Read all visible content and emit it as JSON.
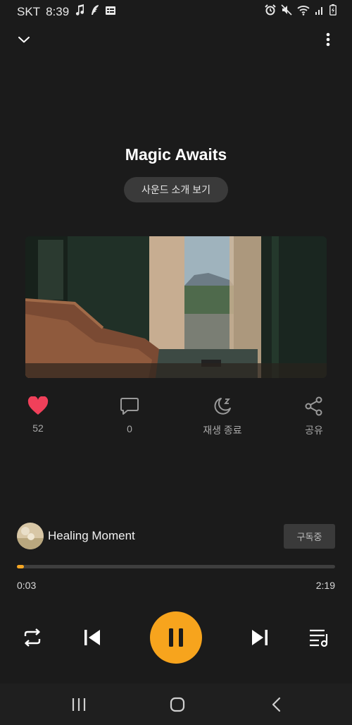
{
  "status_bar": {
    "carrier": "SKT",
    "time": "8:39"
  },
  "track": {
    "title": "Magic Awaits",
    "intro_button": "사운드 소개 보기"
  },
  "actions": {
    "like_count": "52",
    "comment_count": "0",
    "sleep_timer_label": "재생 종료",
    "share_label": "공유"
  },
  "channel": {
    "name": "Healing Moment",
    "subscribe_label": "구독중"
  },
  "playback": {
    "elapsed": "0:03",
    "duration": "2:19",
    "progress": 0.0216
  },
  "colors": {
    "accent": "#f7a41d",
    "like": "#f0405a",
    "background": "#1b1b1b"
  },
  "icons": {
    "collapse": "chevron-down-icon",
    "more": "more-vertical-icon",
    "like": "heart-icon",
    "comment": "comment-icon",
    "sleep": "moon-sleep-icon",
    "share": "share-icon",
    "repeat": "repeat-icon",
    "previous": "skip-previous-icon",
    "pause": "pause-icon",
    "next": "skip-next-icon",
    "playlist": "playlist-icon"
  }
}
